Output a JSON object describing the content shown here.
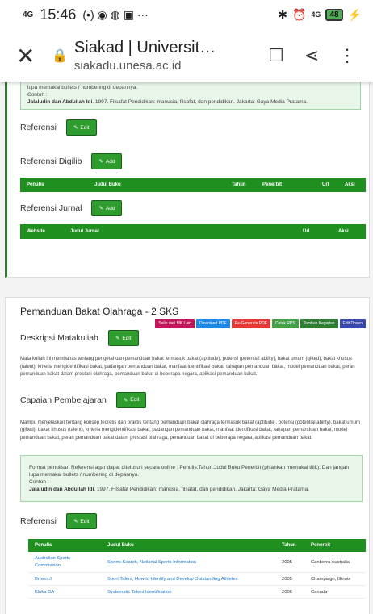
{
  "status": {
    "signal": "4G",
    "time": "15:46",
    "icons_left": "(•) ◉ ◍ ▣ ···",
    "net": "4G",
    "battery": "48"
  },
  "browser": {
    "title": "Siakad | Universit…",
    "url": "siakadu.unesa.ac.id"
  },
  "card1": {
    "notice_line1": "lupa memakai bullets / numbering di depannya.",
    "notice_contoh": "Contoh :",
    "notice_author": "Jalaludin dan Abdullah Idi",
    "notice_rest": ". 1997. Filsafat Pendidikan: manusia, filsafat, dan pendidikan. Jakarta: Gaya Media Pratama.",
    "referensi": "Referensi",
    "edit": "Edit",
    "ref_digilib": "Referensi Digilib",
    "add": "Add",
    "digilib_cols": [
      "Penulis",
      "Judul Buku",
      "Tahun",
      "Penerbit",
      "Url",
      "Aksi"
    ],
    "ref_jurnal": "Referensi Jurnal",
    "jurnal_cols": [
      "Website",
      "Judul Jurnal",
      "Url",
      "Aksi"
    ]
  },
  "card2": {
    "title": "Pemanduan Bakat Olahraga - 2 SKS",
    "actions": [
      {
        "label": "Salin dari MK Lain",
        "color": "#c2185b"
      },
      {
        "label": "Download PDF",
        "color": "#1e88e5"
      },
      {
        "label": "Re-Generate PDF",
        "color": "#e53935"
      },
      {
        "label": "Cetak RPS",
        "color": "#43a047"
      },
      {
        "label": "Tambah Kegiatan",
        "color": "#2e7d32"
      },
      {
        "label": "Edit Dosen",
        "color": "#3949ab"
      }
    ],
    "deskripsi": "Deskripsi Matakuliah",
    "edit": "Edit",
    "deskripsi_text": "Mata kuliah ini membahas tentang pengetahuan pemanduan bakat termasuk bakat (aptitude), potensi (potential ability), bakat umum (gifted), bakat khusus (talent), kriteria mengidentifikasi bakat, padangan pemanduan bakat, manfaat identifikasi bakat, tahapan pemanduan bakat, model pemanduan bakat, peran pemanduan bakat dalam prestasi olahraga, pemanduan bakat di beberapa negara, aplikasi pemanduan bakat.",
    "capaian": "Capaian Pembelajaran",
    "capaian_text": "Mampu menjelaskan tentang konsep teoretis dan praktis tentang pemanduan bakat olahraga termasuk bakat (aptitude), potensi (potential ability), bakat umum (gifted), bakat khusus (talent), kriteria mengidentifikasi bakat, padangan pemanduan bakat, manfaat identifikasi bakat, tahapan pemanduan bakat, model pemanduan bakat, peran pemanduan bakat dalam prestasi olahraga, pemanduan bakat di beberapa negara, aplikasi pemanduan bakat.",
    "notice_line0": "Format penulisan Referensi agar dapat ditelusuri secara online : Penulis.Tahun.Judul Buku.Penerbit (pisahkan memakai titik). Dan jangan",
    "notice_line1": "lupa memakai bullets / numbering di depannya.",
    "notice_contoh": "Contoh :",
    "notice_author": "Jalaludin dan Abdullah Idi",
    "notice_rest": ". 1997. Filsafat Pendidikan: manusia, filsafat, dan pendidikan. Jakarta: Gaya Media Pratama.",
    "referensi": "Referensi",
    "ref_cols": [
      "Penulis",
      "Judul Buku",
      "Tahun",
      "Penerbit"
    ],
    "rows": [
      {
        "penulis": "Australian Sports Commission",
        "judul": "Sports Search, National Sports Information",
        "tahun": "2005",
        "penerbit": "Canberra Australia"
      },
      {
        "penulis": "Brown J",
        "judul": "Sport Talent, How to Identify and Develop Outstanding Athletes",
        "tahun": "2005",
        "penerbit": "Champaign, Illinois"
      },
      {
        "penulis": "Kluka DA",
        "judul": "Systematic Talent Identification",
        "tahun": "2006",
        "penerbit": "Canada"
      }
    ]
  }
}
